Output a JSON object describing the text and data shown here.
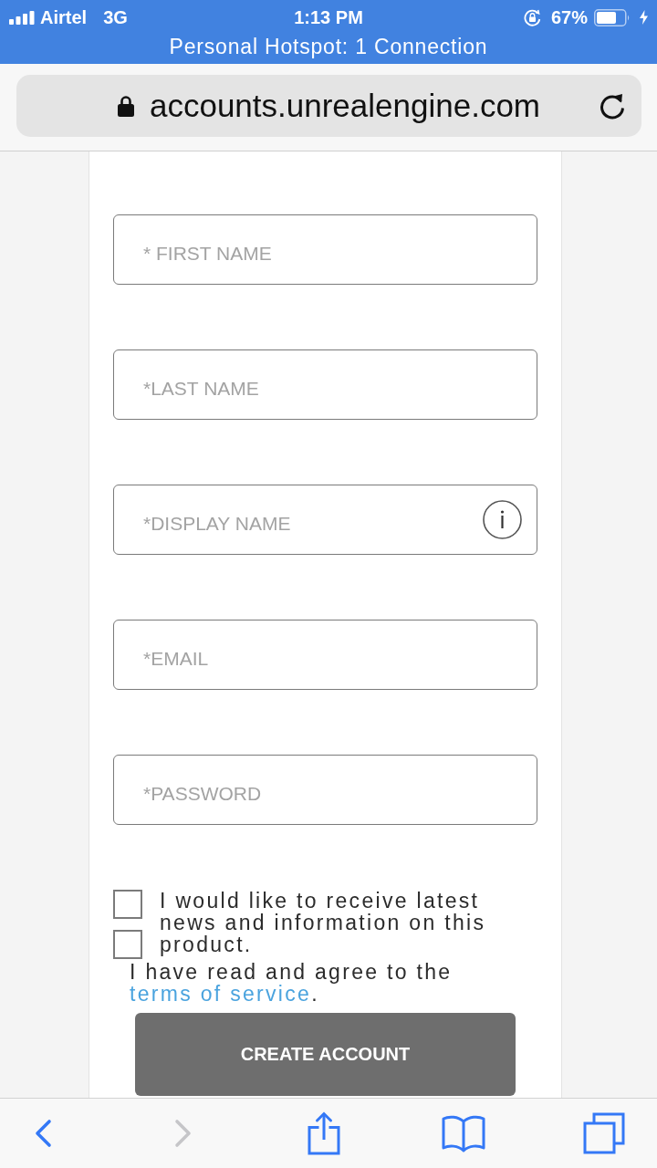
{
  "status_bar": {
    "carrier": "Airtel",
    "network": "3G",
    "time": "1:13 PM",
    "battery_percent": "67%",
    "charging": true,
    "hotspot_banner": "Personal Hotspot: 1 Connection"
  },
  "address_bar": {
    "url": "accounts.unrealengine.com",
    "secure": true
  },
  "form": {
    "fields": [
      {
        "placeholder": "* FIRST NAME",
        "info": false
      },
      {
        "placeholder": "*LAST NAME",
        "info": false
      },
      {
        "placeholder": "*DISPLAY NAME",
        "info": true
      },
      {
        "placeholder": "*EMAIL",
        "info": false
      },
      {
        "placeholder": "*PASSWORD",
        "info": false
      }
    ],
    "newsletter": {
      "label": "I would like to receive latest news and information on this product.",
      "checked": false
    },
    "terms": {
      "checked": false,
      "text": "I have read and agree to the ",
      "link": "terms of service",
      "after": "."
    },
    "submit": "CREATE ACCOUNT"
  },
  "toolbar": [
    {
      "kind": "back",
      "disabled": false
    },
    {
      "kind": "forward",
      "disabled": true
    },
    {
      "kind": "share",
      "disabled": false
    },
    {
      "kind": "bookmarks",
      "disabled": false
    },
    {
      "kind": "tabs",
      "disabled": false
    }
  ]
}
